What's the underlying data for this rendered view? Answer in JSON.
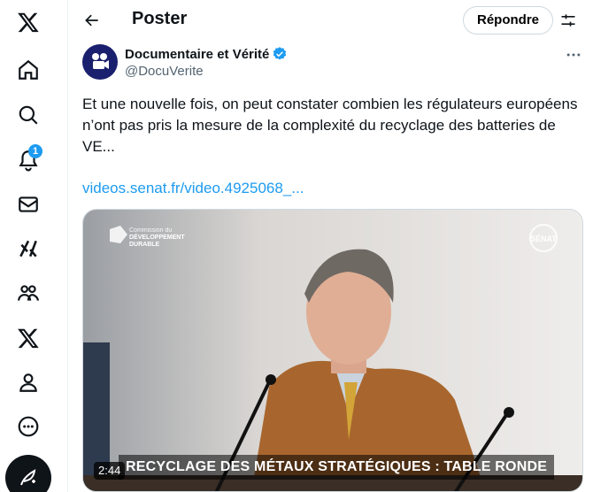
{
  "sidebar": {
    "items": [
      {
        "icon": "x-logo-icon"
      },
      {
        "icon": "home-icon"
      },
      {
        "icon": "search-icon"
      },
      {
        "icon": "notifications-icon",
        "badge": "1"
      },
      {
        "icon": "messages-icon"
      },
      {
        "icon": "grok-icon"
      },
      {
        "icon": "communities-icon"
      },
      {
        "icon": "premium-x-icon"
      },
      {
        "icon": "profile-icon"
      },
      {
        "icon": "more-icon"
      }
    ],
    "compose_icon": "compose-icon"
  },
  "header": {
    "title": "Poster",
    "reply_label": "Répondre"
  },
  "post": {
    "author_name": "Documentaire et Vérité",
    "handle": "@DocuVerite",
    "text": "Et une nouvelle fois, on peut constater combien les régulateurs européens n’ont pas pris la mesure de la complexité du recyclage des batteries de VE...",
    "link": "videos.senat.fr/video.4925068_..."
  },
  "video": {
    "org_small": "Commission du",
    "org_line1": "DÉVELOPPEMENT",
    "org_line2": "DURABLE",
    "logo_text": "SÉNAT",
    "caption": "RECYCLAGE DES MÉTAUX STRATÉGIQUES : TABLE RONDE",
    "duration": "2:44"
  },
  "colors": {
    "accent": "#1d9bf0",
    "text": "#0f1419",
    "secondary": "#536471"
  }
}
